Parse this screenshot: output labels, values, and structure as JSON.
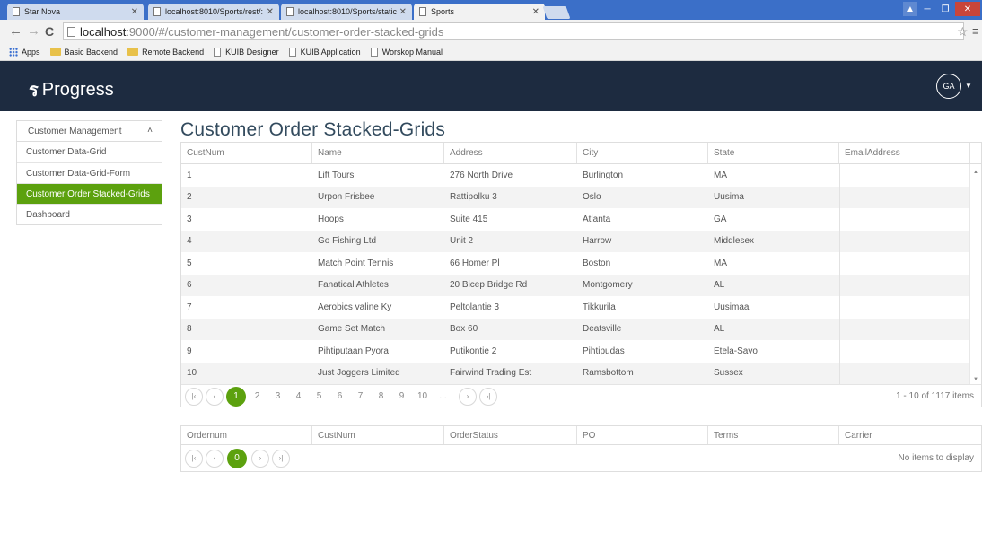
{
  "browser": {
    "tabs": [
      {
        "title": "Star Nova",
        "active": false
      },
      {
        "title": "localhost:8010/Sports/rest/:",
        "active": false
      },
      {
        "title": "localhost:8010/Sports/static",
        "active": false
      },
      {
        "title": "Sports",
        "active": true
      }
    ],
    "url_host": "localhost",
    "url_path": ":9000/#/customer-management/customer-order-stacked-grids",
    "bookmarks": [
      "Apps",
      "Basic Backend",
      "Remote Backend",
      "KUIB Designer",
      "KUIB Application",
      "Worskop Manual"
    ]
  },
  "header": {
    "brand": "Progress",
    "brand_mark": "ร",
    "avatar": "GA"
  },
  "sidebar": {
    "section": "Customer Management",
    "items": [
      {
        "label": "Customer Data-Grid",
        "active": false
      },
      {
        "label": "Customer Data-Grid-Form",
        "active": false
      },
      {
        "label": "Customer Order Stacked-Grids",
        "active": true
      },
      {
        "label": "Dashboard",
        "active": false
      }
    ]
  },
  "main": {
    "title": "Customer Order Stacked-Grids",
    "customers": {
      "columns": [
        "CustNum",
        "Name",
        "Address",
        "City",
        "State",
        "EmailAddress"
      ],
      "rows": [
        [
          "1",
          "Lift Tours",
          "276 North Drive",
          "Burlington",
          "MA",
          ""
        ],
        [
          "2",
          "Urpon Frisbee",
          "Rattipolku 3",
          "Oslo",
          "Uusima",
          ""
        ],
        [
          "3",
          "Hoops",
          "Suite 415",
          "Atlanta",
          "GA",
          ""
        ],
        [
          "4",
          "Go Fishing Ltd",
          "Unit 2",
          "Harrow",
          "Middlesex",
          ""
        ],
        [
          "5",
          "Match Point Tennis",
          "66 Homer Pl",
          "Boston",
          "MA",
          ""
        ],
        [
          "6",
          "Fanatical Athletes",
          "20 Bicep Bridge Rd",
          "Montgomery",
          "AL",
          ""
        ],
        [
          "7",
          "Aerobics valine Ky",
          "Peltolantie 3",
          "Tikkurila",
          "Uusimaa",
          ""
        ],
        [
          "8",
          "Game Set Match",
          "Box 60",
          "Deatsville",
          "AL",
          ""
        ],
        [
          "9",
          "Pihtiputaan Pyora",
          "Putikontie 2",
          "Pihtipudas",
          "Etela-Savo",
          ""
        ],
        [
          "10",
          "Just Joggers Limited",
          "Fairwind Trading Est",
          "Ramsbottom",
          "Sussex",
          ""
        ]
      ],
      "pager": {
        "pages": [
          "1",
          "2",
          "3",
          "4",
          "5",
          "6",
          "7",
          "8",
          "9",
          "10",
          "..."
        ],
        "current": "1",
        "info": "1 - 10 of 1117 items"
      }
    },
    "orders": {
      "columns": [
        "Ordernum",
        "CustNum",
        "OrderStatus",
        "PO",
        "Terms",
        "Carrier"
      ],
      "pager": {
        "current": "0",
        "info": "No items to display"
      }
    }
  }
}
